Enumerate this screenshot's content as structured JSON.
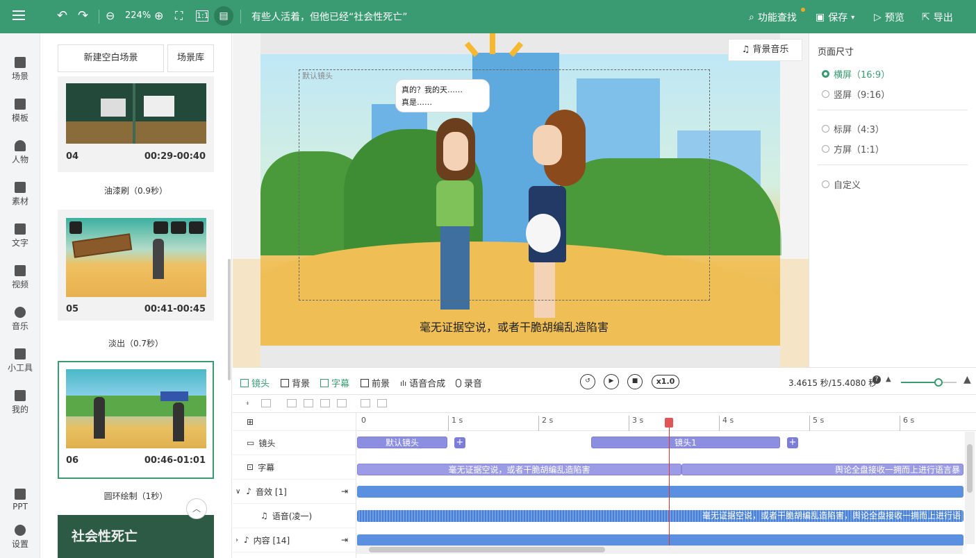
{
  "topbar": {
    "zoom": "224%",
    "project_title": "有些人活着，但他已经“社会性死亡”",
    "feature_search": "功能查找",
    "save": "保存",
    "preview": "预览",
    "export": "导出"
  },
  "leftnav": {
    "items": [
      "场景",
      "模板",
      "人物",
      "素材",
      "文字",
      "视频",
      "音乐",
      "小工具",
      "我的"
    ],
    "bottom": [
      "PPT",
      "设置"
    ]
  },
  "scenes": {
    "new_blank": "新建空白场景",
    "library": "场景库",
    "cards": [
      {
        "num": "04",
        "time": "00:29-00:40"
      },
      {
        "num": "05",
        "time": "00:41-00:45"
      },
      {
        "num": "06",
        "time": "00:46-01:01"
      }
    ],
    "transitions": [
      "油漆刷（0.9秒）",
      "淡出（0.7秒）",
      "圆环绘制（1秒）"
    ],
    "card_title_07": "社会性死亡"
  },
  "canvas": {
    "bgm": "背景音乐",
    "camera_label": "默认镜头",
    "bubble_line1": "真的？我的天……",
    "bubble_line2": "真是……",
    "caption": "毫无证据空说，或者干脆胡编乱造陷害"
  },
  "page_size": {
    "title": "页面尺寸",
    "options": [
      "横屏（16:9）",
      "竖屏（9:16）",
      "标屏（4:3）",
      "方屏（1:1）",
      "自定义"
    ],
    "selected": "横屏（16:9）"
  },
  "timeline": {
    "tabs": [
      "镜头",
      "背景",
      "字幕",
      "前景",
      "语音合成",
      "录音"
    ],
    "active_tab": "字幕",
    "speed": "x1.0",
    "time_display": "3.4615 秒/15.4080 秒",
    "ruler": [
      "0",
      "1 s",
      "2 s",
      "3 s",
      "4 s",
      "5 s",
      "6 s"
    ],
    "rows": {
      "lens": "镜头",
      "subtitle": "字幕",
      "sfx": "音效 [1]",
      "voice": "语音(凌一)",
      "content": "内容 [14]"
    },
    "lens_blocks": [
      "默认镜头",
      "镜头1"
    ],
    "subtitle_blocks": [
      "毫无证据空说，或者干脆胡编乱造陷害",
      "舆论全盘接收一拥而上进行语言暴"
    ],
    "voice_text": "毫无证据空说，或者干脆胡编乱造陷害，舆论全盘接收一拥而上进行语"
  },
  "colors": {
    "accent": "#3a9b72",
    "playhead": "#dd3333"
  }
}
